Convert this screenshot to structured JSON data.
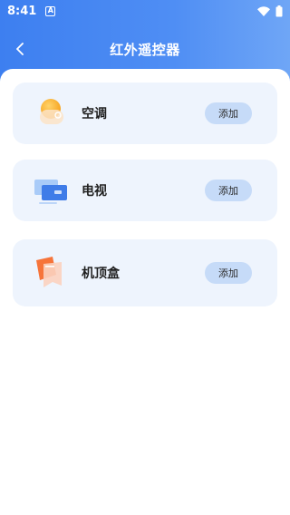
{
  "status_bar": {
    "time": "8:41",
    "notification_badge": "A"
  },
  "nav": {
    "title": "红外遥控器"
  },
  "devices": [
    {
      "label": "空调",
      "icon": "air-conditioner-icon",
      "button": "添加"
    },
    {
      "label": "电视",
      "icon": "tv-icon",
      "button": "添加"
    },
    {
      "label": "机顶盒",
      "icon": "set-top-box-icon",
      "button": "添加"
    }
  ],
  "colors": {
    "header_gradient_start": "#3d7ff0",
    "header_gradient_end": "#6fa6f6",
    "card_bg": "#eef4fd",
    "button_bg": "#c6dbf8"
  }
}
